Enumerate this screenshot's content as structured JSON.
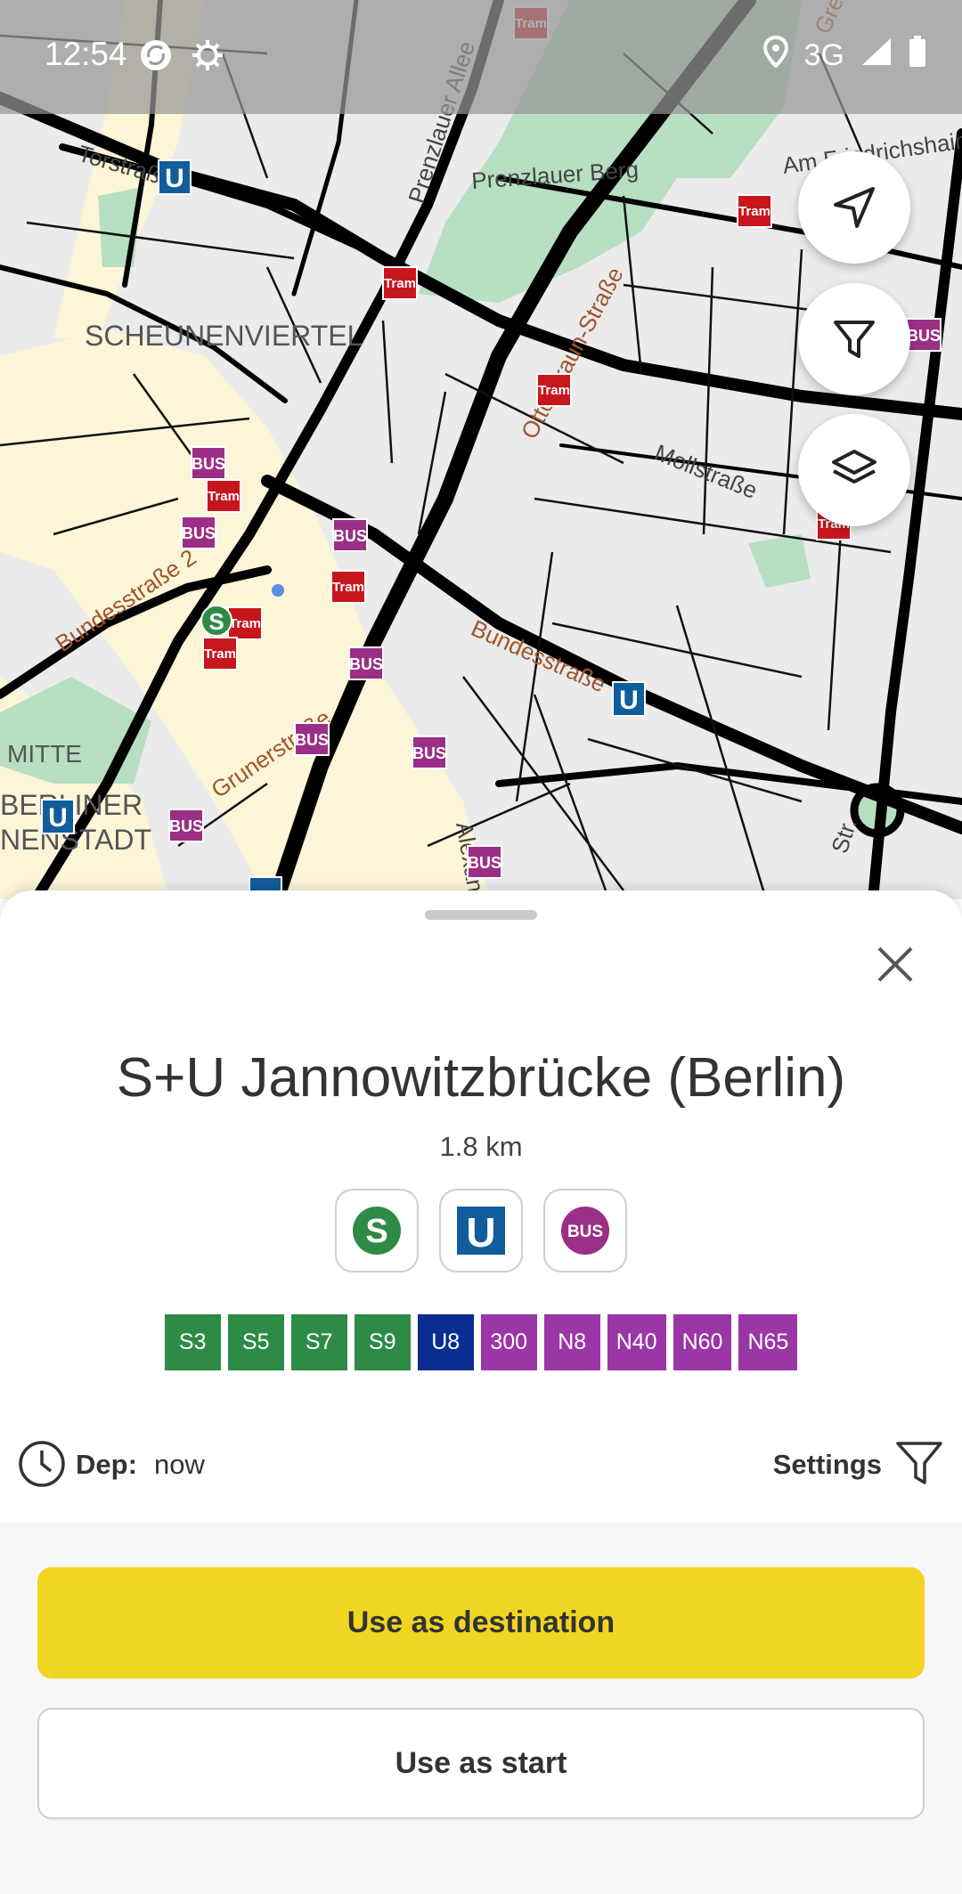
{
  "status_bar": {
    "time": "12:54",
    "network": "3G",
    "icons": [
      "sync-icon",
      "debug-gear-icon",
      "location-icon",
      "signal-icon",
      "battery-icon"
    ]
  },
  "map": {
    "labels": [
      "Torstraße",
      "Prenzlauer Allee",
      "Prenzlauer Berg",
      "SCHEUNENVIERTEL",
      "Otto-Braun-Straße",
      "Mollstraße",
      "Bundesstraße 2",
      "Bundesstraße",
      "Grunerstraße",
      "MITTE",
      "BERLINER",
      "NENSTADT",
      "Alexanderstr.",
      "Greifswalder Str.",
      "Am Friedrichshain"
    ],
    "stop_badges": [
      "Tram",
      "BUS",
      "U",
      "S"
    ],
    "controls": [
      "my-location-button",
      "filter-button",
      "layers-button"
    ]
  },
  "sheet": {
    "title": "S+U Jannowitzbrücke (Berlin)",
    "distance": "1.8 km",
    "modes": [
      {
        "name": "S",
        "color": "#2e8b46"
      },
      {
        "name": "U",
        "color": "#115d9c"
      },
      {
        "name": "BUS",
        "color": "#9b2f85"
      }
    ],
    "lines": [
      {
        "label": "S3",
        "color": "#2e8b46"
      },
      {
        "label": "S5",
        "color": "#2e8b46"
      },
      {
        "label": "S7",
        "color": "#2e8b46"
      },
      {
        "label": "S9",
        "color": "#2e8b46"
      },
      {
        "label": "U8",
        "color": "#0b2d91"
      },
      {
        "label": "300",
        "color": "#9b36a6"
      },
      {
        "label": "N8",
        "color": "#9b36a6"
      },
      {
        "label": "N40",
        "color": "#9b36a6"
      },
      {
        "label": "N60",
        "color": "#9b36a6"
      },
      {
        "label": "N65",
        "color": "#9b36a6"
      }
    ],
    "departure": {
      "label": "Dep:",
      "value": "now"
    },
    "settings_label": "Settings",
    "use_as_destination": "Use as destination",
    "use_as_start": "Use as start"
  },
  "colors": {
    "accent": "#f0d523",
    "tram": "#c8161d",
    "bus": "#9b2f85",
    "ubahn": "#115d9c",
    "sbahn": "#2e8b46"
  }
}
